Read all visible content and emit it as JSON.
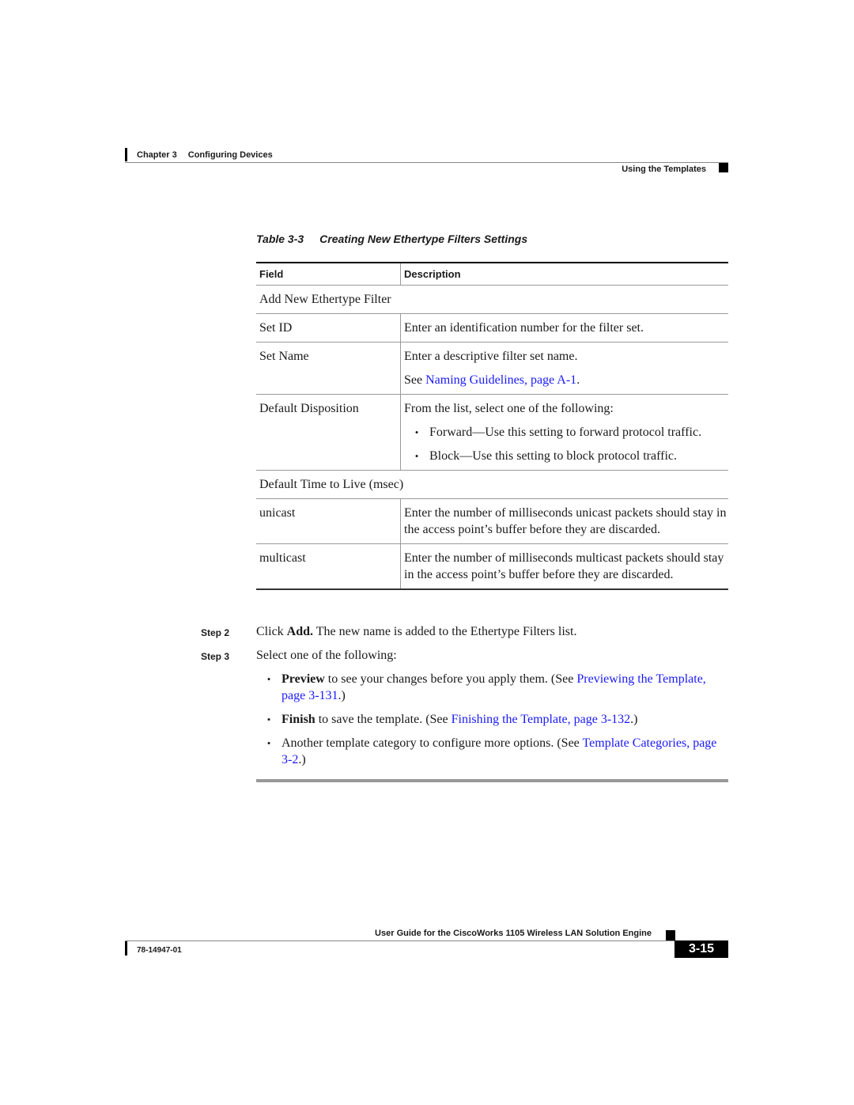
{
  "header": {
    "chapter_label": "Chapter 3",
    "chapter_title": "Configuring Devices",
    "section_title": "Using the Templates"
  },
  "table": {
    "number": "Table 3-3",
    "title": "Creating New Ethertype Filters Settings",
    "columns": [
      "Field",
      "Description"
    ],
    "rows": [
      {
        "type": "group",
        "field": "Add New Ethertype Filter"
      },
      {
        "field": "Set ID",
        "description": [
          "Enter an identification number for the filter set."
        ]
      },
      {
        "field": "Set Name",
        "description": [
          "Enter a descriptive filter set name."
        ],
        "see_prefix": "See ",
        "see_link": "Naming Guidelines, page A-1",
        "see_suffix": "."
      },
      {
        "field": "Default Disposition",
        "description": [
          "From the list, select one of the following:"
        ],
        "bullets": [
          "Forward—Use this setting to forward protocol traffic.",
          "Block—Use this setting to block protocol traffic."
        ]
      },
      {
        "type": "group",
        "field": "Default Time to Live (msec)"
      },
      {
        "field": "unicast",
        "description": [
          "Enter the number of milliseconds unicast packets should stay in the access point’s buffer before they are discarded."
        ]
      },
      {
        "field": "multicast",
        "description": [
          "Enter the number of milliseconds multicast packets should stay in the access point’s buffer before they are discarded."
        ]
      }
    ]
  },
  "steps": [
    {
      "label": "Step 2",
      "pre": "Click ",
      "bold": "Add.",
      "post": " The new name is added to the Ethertype Filters list."
    },
    {
      "label": "Step 3",
      "text": "Select one of the following:"
    }
  ],
  "options": [
    {
      "bold": "Preview",
      "text": " to see your changes before you apply them. (See ",
      "link": "Previewing the Template, page 3-131",
      "suffix": ".)"
    },
    {
      "bold": "Finish",
      "text": " to save the template. (See ",
      "link": "Finishing the Template, page 3-132",
      "suffix": ".)"
    },
    {
      "bold": "",
      "text": "Another template category to configure more options. (See ",
      "link": "Template Categories, page 3-2",
      "suffix": ".)"
    }
  ],
  "bullet_glyph": "•",
  "footer": {
    "guide_title": "User Guide for the CiscoWorks 1105 Wireless LAN Solution Engine",
    "doc_number": "78-14947-01",
    "page_number": "3-15"
  },
  "colors": {
    "link": "#1a1aff"
  }
}
